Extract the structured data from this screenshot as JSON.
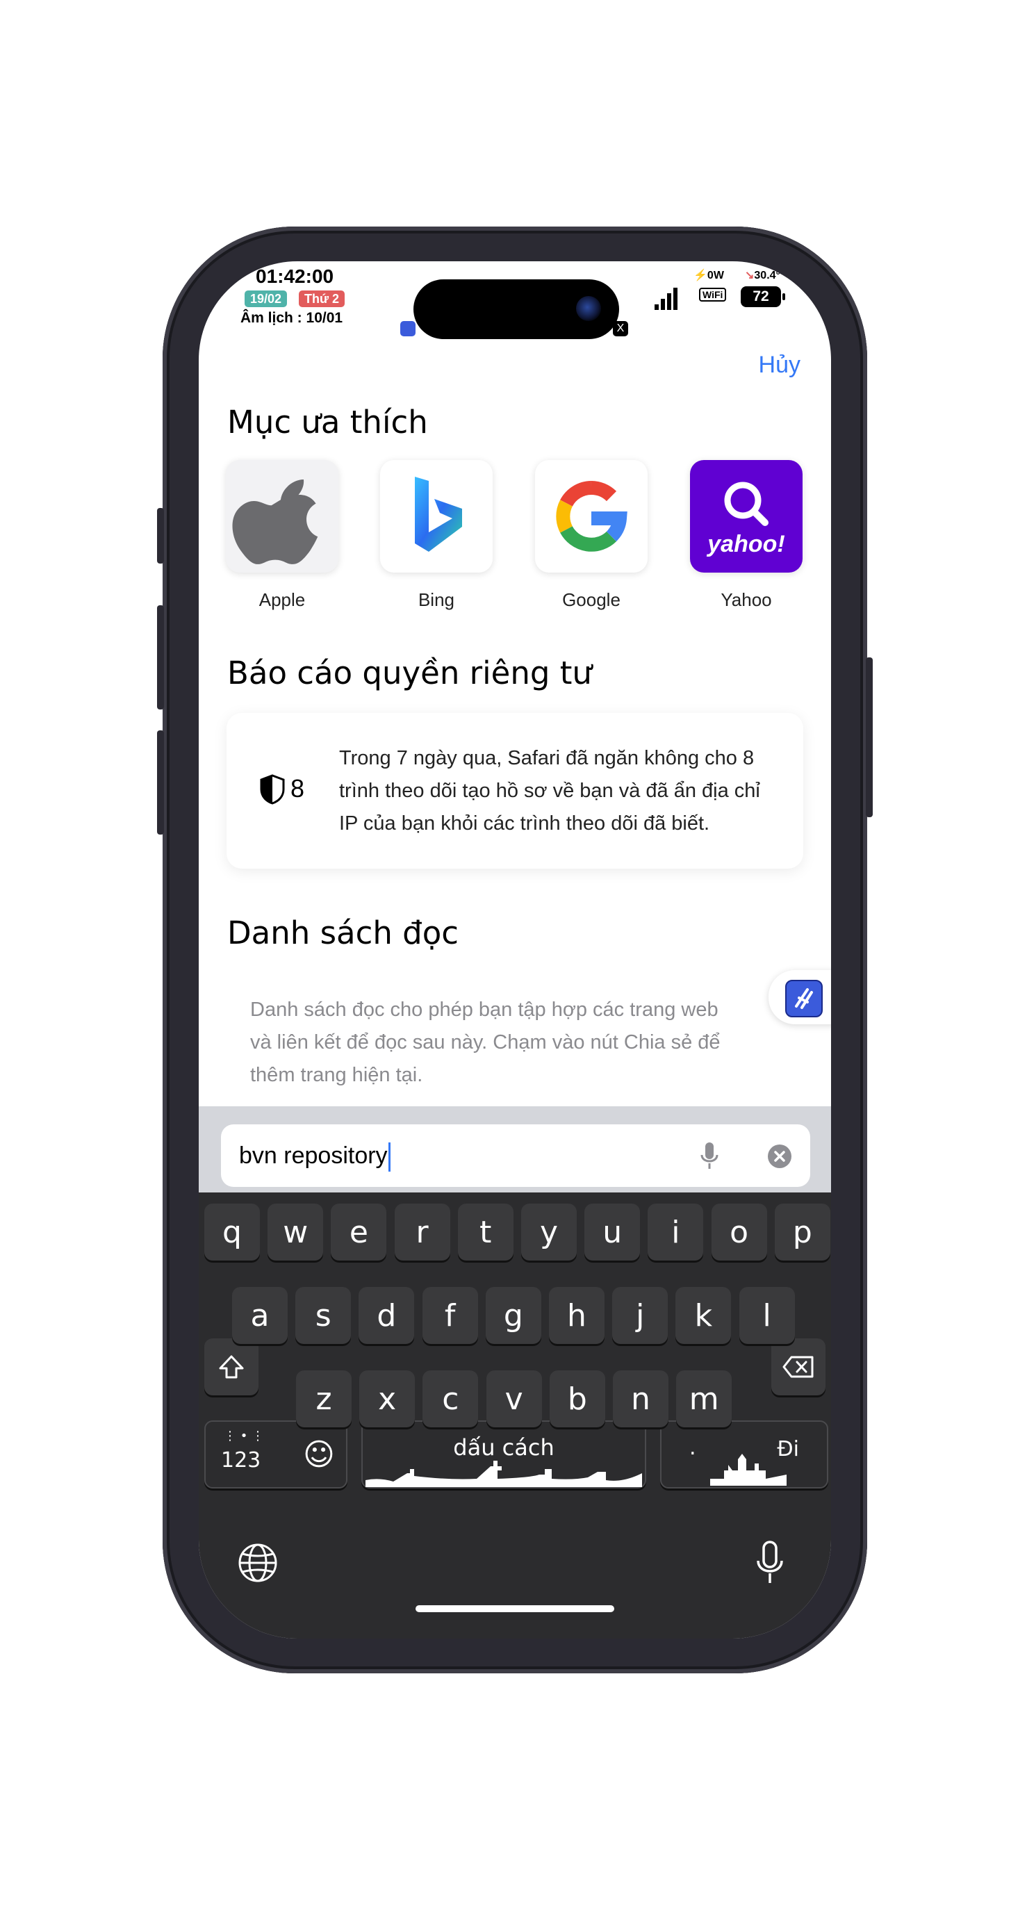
{
  "status_bar": {
    "time": "01:42:00",
    "date_badge": "19/02",
    "weekday_badge": "Thứ 2",
    "lunar_date": "Âm lịch : 10/01",
    "power_readout": "0W",
    "temperature": "30.4°",
    "wifi_label": "WiFi",
    "battery": "72"
  },
  "header": {
    "cancel_label": "Hủy"
  },
  "favorites": {
    "title": "Mục ưa thích",
    "items": [
      {
        "label": "Apple",
        "icon": "apple-logo-icon"
      },
      {
        "label": "Bing",
        "icon": "bing-logo-icon"
      },
      {
        "label": "Google",
        "icon": "google-logo-icon"
      },
      {
        "label": "Yahoo",
        "icon": "yahoo-logo-icon",
        "tile_text": "yahoo!"
      }
    ]
  },
  "privacy": {
    "title": "Báo cáo quyền riêng tư",
    "tracker_count": "8",
    "description": "Trong 7 ngày qua, Safari đã ngăn không cho 8 trình theo dõi tạo hồ sơ về bạn và đã ẩn địa chỉ IP của bạn khỏi các trình theo dõi đã biết."
  },
  "reading_list": {
    "title": "Danh sách đọc",
    "description": "Danh sách đọc cho phép bạn tập hợp các trang web và liên kết để đọc sau này. Chạm vào nút Chia sẻ để thêm trang hiện tại."
  },
  "search": {
    "value": "bvn repository"
  },
  "keyboard": {
    "row1": [
      "q",
      "w",
      "e",
      "r",
      "t",
      "y",
      "u",
      "i",
      "o",
      "p"
    ],
    "row2": [
      "a",
      "s",
      "d",
      "f",
      "g",
      "h",
      "j",
      "k",
      "l"
    ],
    "row3": [
      "z",
      "x",
      "c",
      "v",
      "b",
      "n",
      "m"
    ],
    "numbers_label": "123",
    "space_label": "dấu cách",
    "go_label": "Đi",
    "period_label": "."
  },
  "colors": {
    "accent": "#3478f6",
    "keyboard_bg": "#2c2c2e",
    "key_bg": "#3a3a3c",
    "yahoo": "#6001d2",
    "date_badge": "#4fb3a9",
    "weekday_badge": "#e25c5c"
  }
}
